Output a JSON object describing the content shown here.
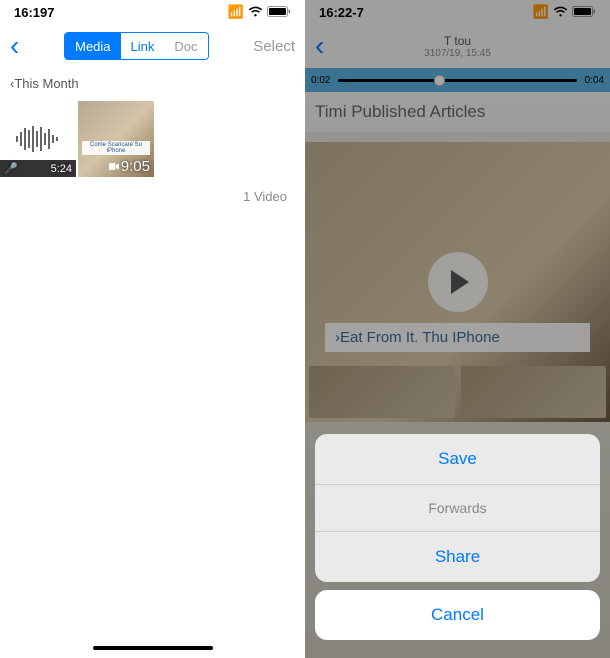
{
  "left": {
    "status": {
      "time": "16:197",
      "signal": "••••",
      "wifi": "wifi",
      "battery": "100"
    },
    "nav": {
      "tabs": {
        "media": "Media",
        "link": "Link",
        "docs": "Doc"
      },
      "select": "Select"
    },
    "section_header": "‹This Month",
    "items": [
      {
        "type": "audio",
        "duration": "5:24"
      },
      {
        "type": "video",
        "duration": "9:05",
        "caption": "Come Scaricare Su iPhone"
      }
    ],
    "count_label": "1 Video"
  },
  "right": {
    "status": {
      "time": "16:22-7",
      "signal": "••••",
      "wifi": "wifi",
      "battery": "100"
    },
    "nav": {
      "title": "T tou",
      "subtitle": "3107/19, 15:45"
    },
    "scrubber": {
      "elapsed": "0:02",
      "remaining": "0:04"
    },
    "article_header": "Timi Published Articles",
    "video_caption": "›Eat From It.      Thu IPhone",
    "action_sheet": {
      "save": "Save",
      "forward": "Forwards",
      "share": "Share",
      "cancel": "Cancel"
    }
  }
}
